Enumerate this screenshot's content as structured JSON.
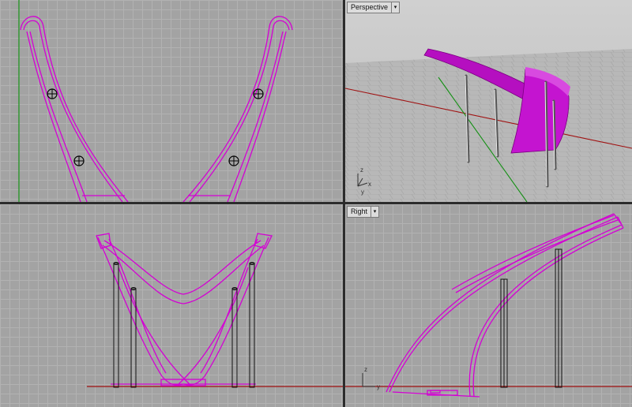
{
  "viewports": {
    "top": {
      "label": ""
    },
    "perspective": {
      "label": "Perspective"
    },
    "front": {
      "label": ""
    },
    "right": {
      "label": "Right"
    }
  },
  "axes": {
    "x": "x",
    "y": "y",
    "z": "z"
  },
  "colors": {
    "curve": "#d400d4",
    "surface": "#bb11cc",
    "column": "#111111",
    "x_axis": "#a01010",
    "y_axis": "#139013",
    "grid_major": "#999999",
    "grid_minor": "#b2b2b2"
  },
  "icons": {
    "dropdown": "chevron-down-icon",
    "point": "control-point-icon"
  }
}
